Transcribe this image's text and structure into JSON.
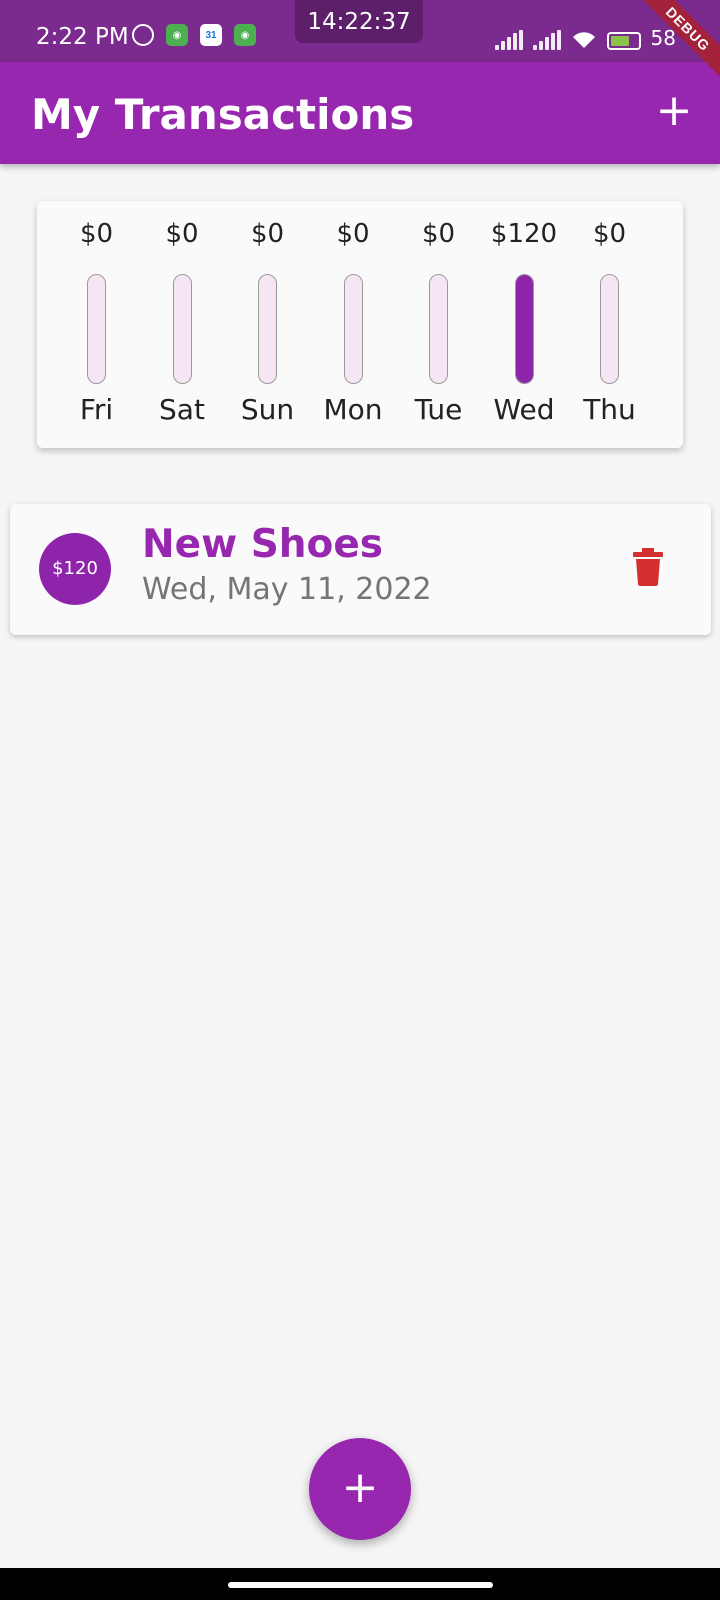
{
  "status_bar": {
    "time": "2:22 PM",
    "clock": "14:22:37",
    "battery": "58",
    "calendar_day": "31",
    "debug_label": "DEBUG"
  },
  "app_bar": {
    "title": "My Transactions",
    "add_label": "+"
  },
  "chart": {
    "days": [
      {
        "day": "Fri",
        "amount": "$0",
        "pct": 0
      },
      {
        "day": "Sat",
        "amount": "$0",
        "pct": 0
      },
      {
        "day": "Sun",
        "amount": "$0",
        "pct": 0
      },
      {
        "day": "Mon",
        "amount": "$0",
        "pct": 0
      },
      {
        "day": "Tue",
        "amount": "$0",
        "pct": 0
      },
      {
        "day": "Wed",
        "amount": "$120",
        "pct": 1
      },
      {
        "day": "Thu",
        "amount": "$0",
        "pct": 0
      }
    ]
  },
  "transactions": [
    {
      "amount": "$120",
      "title": "New Shoes",
      "date": "Wed, May 11, 2022"
    }
  ],
  "fab": {
    "label": "+"
  },
  "colors": {
    "primary": "#9627ae",
    "bar_fill": "#8e24aa",
    "delete": "#d32f2f"
  }
}
